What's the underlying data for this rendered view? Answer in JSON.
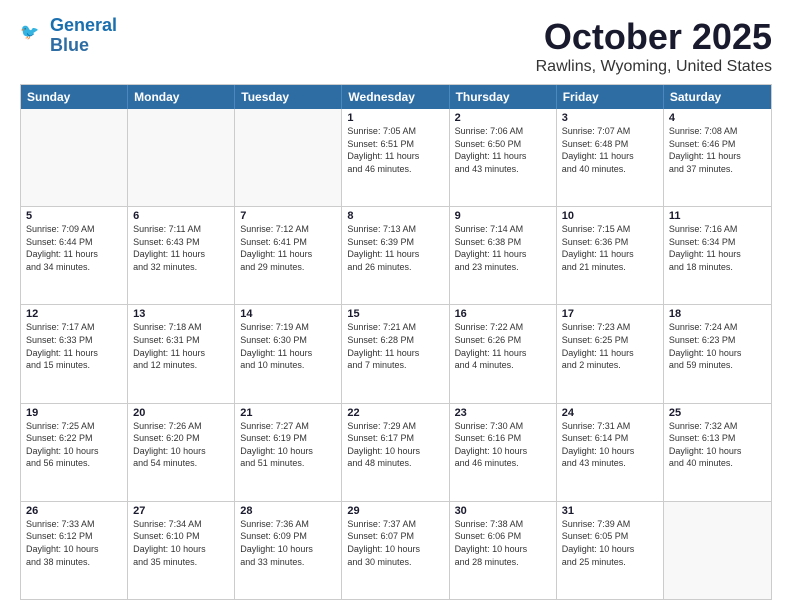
{
  "logo": {
    "line1": "General",
    "line2": "Blue"
  },
  "title": "October 2025",
  "subtitle": "Rawlins, Wyoming, United States",
  "days": [
    "Sunday",
    "Monday",
    "Tuesday",
    "Wednesday",
    "Thursday",
    "Friday",
    "Saturday"
  ],
  "rows": [
    [
      {
        "day": "",
        "info": ""
      },
      {
        "day": "",
        "info": ""
      },
      {
        "day": "",
        "info": ""
      },
      {
        "day": "1",
        "info": "Sunrise: 7:05 AM\nSunset: 6:51 PM\nDaylight: 11 hours\nand 46 minutes."
      },
      {
        "day": "2",
        "info": "Sunrise: 7:06 AM\nSunset: 6:50 PM\nDaylight: 11 hours\nand 43 minutes."
      },
      {
        "day": "3",
        "info": "Sunrise: 7:07 AM\nSunset: 6:48 PM\nDaylight: 11 hours\nand 40 minutes."
      },
      {
        "day": "4",
        "info": "Sunrise: 7:08 AM\nSunset: 6:46 PM\nDaylight: 11 hours\nand 37 minutes."
      }
    ],
    [
      {
        "day": "5",
        "info": "Sunrise: 7:09 AM\nSunset: 6:44 PM\nDaylight: 11 hours\nand 34 minutes."
      },
      {
        "day": "6",
        "info": "Sunrise: 7:11 AM\nSunset: 6:43 PM\nDaylight: 11 hours\nand 32 minutes."
      },
      {
        "day": "7",
        "info": "Sunrise: 7:12 AM\nSunset: 6:41 PM\nDaylight: 11 hours\nand 29 minutes."
      },
      {
        "day": "8",
        "info": "Sunrise: 7:13 AM\nSunset: 6:39 PM\nDaylight: 11 hours\nand 26 minutes."
      },
      {
        "day": "9",
        "info": "Sunrise: 7:14 AM\nSunset: 6:38 PM\nDaylight: 11 hours\nand 23 minutes."
      },
      {
        "day": "10",
        "info": "Sunrise: 7:15 AM\nSunset: 6:36 PM\nDaylight: 11 hours\nand 21 minutes."
      },
      {
        "day": "11",
        "info": "Sunrise: 7:16 AM\nSunset: 6:34 PM\nDaylight: 11 hours\nand 18 minutes."
      }
    ],
    [
      {
        "day": "12",
        "info": "Sunrise: 7:17 AM\nSunset: 6:33 PM\nDaylight: 11 hours\nand 15 minutes."
      },
      {
        "day": "13",
        "info": "Sunrise: 7:18 AM\nSunset: 6:31 PM\nDaylight: 11 hours\nand 12 minutes."
      },
      {
        "day": "14",
        "info": "Sunrise: 7:19 AM\nSunset: 6:30 PM\nDaylight: 11 hours\nand 10 minutes."
      },
      {
        "day": "15",
        "info": "Sunrise: 7:21 AM\nSunset: 6:28 PM\nDaylight: 11 hours\nand 7 minutes."
      },
      {
        "day": "16",
        "info": "Sunrise: 7:22 AM\nSunset: 6:26 PM\nDaylight: 11 hours\nand 4 minutes."
      },
      {
        "day": "17",
        "info": "Sunrise: 7:23 AM\nSunset: 6:25 PM\nDaylight: 11 hours\nand 2 minutes."
      },
      {
        "day": "18",
        "info": "Sunrise: 7:24 AM\nSunset: 6:23 PM\nDaylight: 10 hours\nand 59 minutes."
      }
    ],
    [
      {
        "day": "19",
        "info": "Sunrise: 7:25 AM\nSunset: 6:22 PM\nDaylight: 10 hours\nand 56 minutes."
      },
      {
        "day": "20",
        "info": "Sunrise: 7:26 AM\nSunset: 6:20 PM\nDaylight: 10 hours\nand 54 minutes."
      },
      {
        "day": "21",
        "info": "Sunrise: 7:27 AM\nSunset: 6:19 PM\nDaylight: 10 hours\nand 51 minutes."
      },
      {
        "day": "22",
        "info": "Sunrise: 7:29 AM\nSunset: 6:17 PM\nDaylight: 10 hours\nand 48 minutes."
      },
      {
        "day": "23",
        "info": "Sunrise: 7:30 AM\nSunset: 6:16 PM\nDaylight: 10 hours\nand 46 minutes."
      },
      {
        "day": "24",
        "info": "Sunrise: 7:31 AM\nSunset: 6:14 PM\nDaylight: 10 hours\nand 43 minutes."
      },
      {
        "day": "25",
        "info": "Sunrise: 7:32 AM\nSunset: 6:13 PM\nDaylight: 10 hours\nand 40 minutes."
      }
    ],
    [
      {
        "day": "26",
        "info": "Sunrise: 7:33 AM\nSunset: 6:12 PM\nDaylight: 10 hours\nand 38 minutes."
      },
      {
        "day": "27",
        "info": "Sunrise: 7:34 AM\nSunset: 6:10 PM\nDaylight: 10 hours\nand 35 minutes."
      },
      {
        "day": "28",
        "info": "Sunrise: 7:36 AM\nSunset: 6:09 PM\nDaylight: 10 hours\nand 33 minutes."
      },
      {
        "day": "29",
        "info": "Sunrise: 7:37 AM\nSunset: 6:07 PM\nDaylight: 10 hours\nand 30 minutes."
      },
      {
        "day": "30",
        "info": "Sunrise: 7:38 AM\nSunset: 6:06 PM\nDaylight: 10 hours\nand 28 minutes."
      },
      {
        "day": "31",
        "info": "Sunrise: 7:39 AM\nSunset: 6:05 PM\nDaylight: 10 hours\nand 25 minutes."
      },
      {
        "day": "",
        "info": ""
      }
    ]
  ]
}
